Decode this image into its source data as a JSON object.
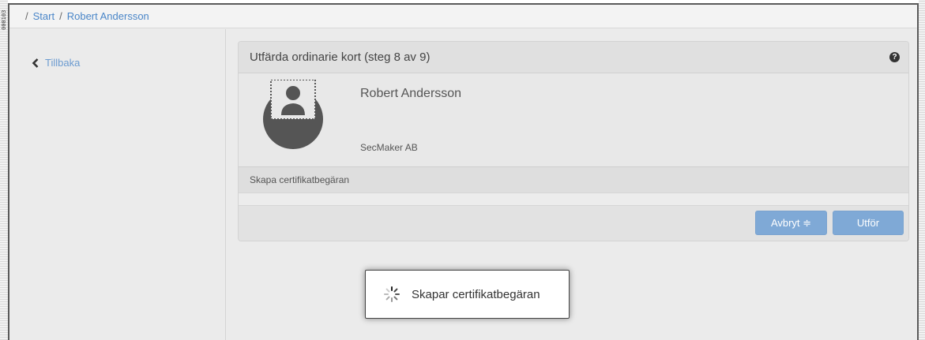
{
  "side_label": "000103",
  "breadcrumb": {
    "separator": "/",
    "items": [
      "Start",
      "Robert Andersson"
    ]
  },
  "sidebar": {
    "back_label": "Tillbaka",
    "back_icon": "chevron-left-icon"
  },
  "panel": {
    "title": "Utfärda ordinarie kort (steg 8 av 9)",
    "help_icon": "question-circle-icon",
    "help_glyph": "?",
    "person": {
      "name": "Robert Andersson",
      "organization": "SecMaker AB",
      "avatar_icon": "user-photo-placeholder-icon"
    },
    "step_label": "Skapa certifikatbegäran",
    "buttons": {
      "cancel_label": "Avbryt ≑",
      "execute_label": "Utför"
    }
  },
  "toast": {
    "icon": "spinner-icon",
    "message": "Skapar certifikatbegäran"
  },
  "colors": {
    "link": "#4a86c8",
    "button": "#7fa9d6",
    "background": "#ebebeb",
    "avatar": "#555555"
  }
}
